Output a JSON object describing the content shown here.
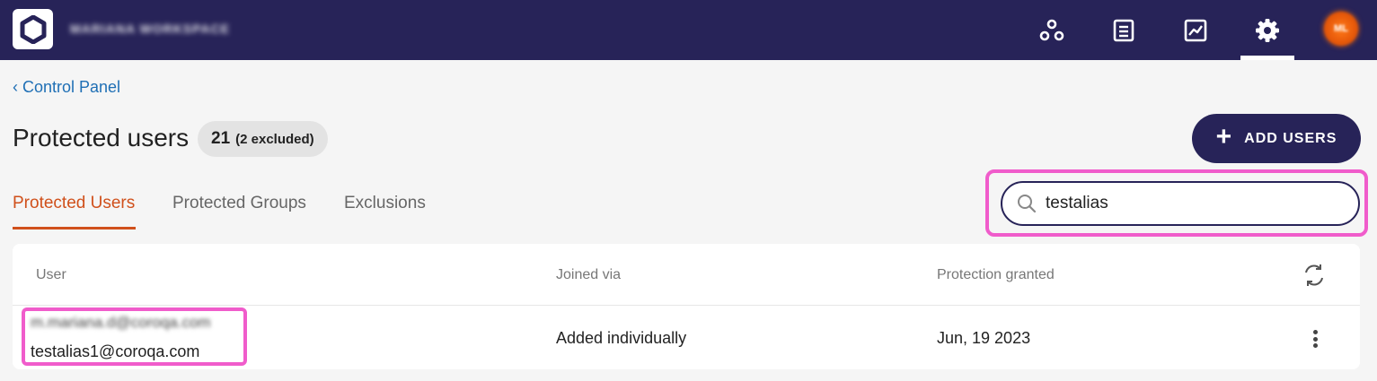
{
  "topbar": {
    "workspace_name": "MARIANA WORKSPACE",
    "nav_icons": [
      "graph-nodes-icon",
      "list-document-icon",
      "analytics-chart-icon",
      "gear-icon"
    ],
    "active_nav": "gear-icon",
    "avatar_initials": "ML",
    "bg_color": "#272358"
  },
  "breadcrumb": {
    "label": "‹ Control Panel"
  },
  "header": {
    "title": "Protected users",
    "count": "21",
    "excluded": "(2 excluded)"
  },
  "actions": {
    "add_users_label": "ADD USERS"
  },
  "tabs": [
    {
      "label": "Protected Users",
      "active": true
    },
    {
      "label": "Protected Groups",
      "active": false
    },
    {
      "label": "Exclusions",
      "active": false
    }
  ],
  "search": {
    "value": "testalias"
  },
  "table": {
    "columns": [
      "User",
      "Joined via",
      "Protection granted"
    ],
    "rows": [
      {
        "user_primary": "m.mariana.d@coroqa.com",
        "user_alias": "testalias1@coroqa.com",
        "joined_via": "Added individually",
        "protection_granted": "Jun, 19 2023"
      }
    ]
  },
  "colors": {
    "accent": "#d0501b",
    "link": "#1f6fb5",
    "highlight": "#f05ccb"
  }
}
